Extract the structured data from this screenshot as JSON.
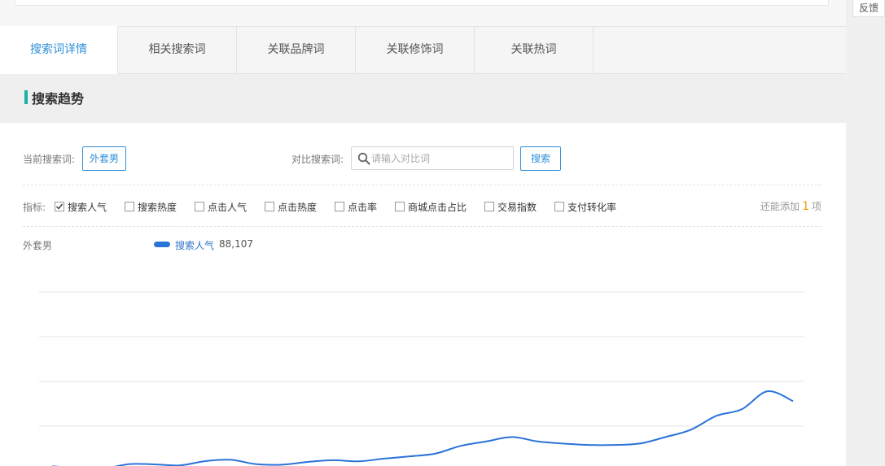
{
  "feedback": {
    "label": "反馈"
  },
  "tabs": [
    {
      "label": "搜索词详情",
      "active": true
    },
    {
      "label": "相关搜索词",
      "active": false
    },
    {
      "label": "关联品牌词",
      "active": false
    },
    {
      "label": "关联修饰词",
      "active": false
    },
    {
      "label": "关联热词",
      "active": false
    }
  ],
  "section": {
    "title": "搜索趋势"
  },
  "query": {
    "current_label": "当前搜索词:",
    "current_value": "外套男",
    "compare_label": "对比搜索词:",
    "compare_placeholder": "请输入对比词",
    "search_button": "搜索"
  },
  "metrics": {
    "label": "指标:",
    "items": [
      {
        "label": "搜索人气",
        "checked": true
      },
      {
        "label": "搜索热度",
        "checked": false
      },
      {
        "label": "点击人气",
        "checked": false
      },
      {
        "label": "点击热度",
        "checked": false
      },
      {
        "label": "点击率",
        "checked": false
      },
      {
        "label": "商城点击占比",
        "checked": false
      },
      {
        "label": "交易指数",
        "checked": false
      },
      {
        "label": "支付转化率",
        "checked": false
      }
    ],
    "remaining_prefix": "还能添加",
    "remaining_count": "1",
    "remaining_suffix": "项"
  },
  "chart_data": {
    "type": "line",
    "keyword_label": "外套男",
    "series": [
      {
        "name": "搜索人气",
        "value_label": "88,107",
        "color": "#2a73d8",
        "values": [
          0.105,
          0.057,
          0.048,
          0.151,
          0.146,
          0.123,
          0.219,
          0.247,
          0.149,
          0.138,
          0.2,
          0.238,
          0.214,
          0.274,
          0.324,
          0.386,
          0.56,
          0.659,
          0.756,
          0.659,
          0.611,
          0.58,
          0.58,
          0.611,
          0.755,
          0.92,
          1.23,
          1.38,
          1.78,
          1.56
        ]
      }
    ],
    "gridlines": 4,
    "grid": true,
    "legend": "top-left"
  },
  "colors": {
    "accent": "#2e8fd9",
    "section_marker": "#17b1a8",
    "count_highlight": "#f39800",
    "line": "#2a73d8"
  }
}
